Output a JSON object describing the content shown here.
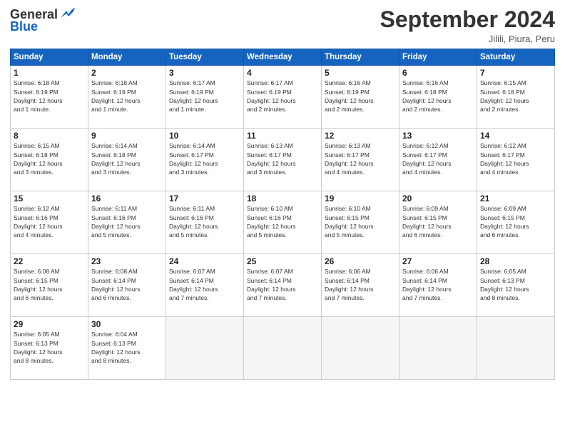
{
  "logo": {
    "general": "General",
    "blue": "Blue",
    "bird_symbol": "▶"
  },
  "title": "September 2024",
  "subtitle": "Jilili, Piura, Peru",
  "header_days": [
    "Sunday",
    "Monday",
    "Tuesday",
    "Wednesday",
    "Thursday",
    "Friday",
    "Saturday"
  ],
  "weeks": [
    [
      {
        "day": "1",
        "info": "Sunrise: 6:18 AM\nSunset: 6:19 PM\nDaylight: 12 hours\nand 1 minute."
      },
      {
        "day": "2",
        "info": "Sunrise: 6:18 AM\nSunset: 6:19 PM\nDaylight: 12 hours\nand 1 minute."
      },
      {
        "day": "3",
        "info": "Sunrise: 6:17 AM\nSunset: 6:19 PM\nDaylight: 12 hours\nand 1 minute."
      },
      {
        "day": "4",
        "info": "Sunrise: 6:17 AM\nSunset: 6:19 PM\nDaylight: 12 hours\nand 2 minutes."
      },
      {
        "day": "5",
        "info": "Sunrise: 6:16 AM\nSunset: 6:19 PM\nDaylight: 12 hours\nand 2 minutes."
      },
      {
        "day": "6",
        "info": "Sunrise: 6:16 AM\nSunset: 6:18 PM\nDaylight: 12 hours\nand 2 minutes."
      },
      {
        "day": "7",
        "info": "Sunrise: 6:15 AM\nSunset: 6:18 PM\nDaylight: 12 hours\nand 2 minutes."
      }
    ],
    [
      {
        "day": "8",
        "info": "Sunrise: 6:15 AM\nSunset: 6:18 PM\nDaylight: 12 hours\nand 3 minutes."
      },
      {
        "day": "9",
        "info": "Sunrise: 6:14 AM\nSunset: 6:18 PM\nDaylight: 12 hours\nand 3 minutes."
      },
      {
        "day": "10",
        "info": "Sunrise: 6:14 AM\nSunset: 6:17 PM\nDaylight: 12 hours\nand 3 minutes."
      },
      {
        "day": "11",
        "info": "Sunrise: 6:13 AM\nSunset: 6:17 PM\nDaylight: 12 hours\nand 3 minutes."
      },
      {
        "day": "12",
        "info": "Sunrise: 6:13 AM\nSunset: 6:17 PM\nDaylight: 12 hours\nand 4 minutes."
      },
      {
        "day": "13",
        "info": "Sunrise: 6:12 AM\nSunset: 6:17 PM\nDaylight: 12 hours\nand 4 minutes."
      },
      {
        "day": "14",
        "info": "Sunrise: 6:12 AM\nSunset: 6:17 PM\nDaylight: 12 hours\nand 4 minutes."
      }
    ],
    [
      {
        "day": "15",
        "info": "Sunrise: 6:12 AM\nSunset: 6:16 PM\nDaylight: 12 hours\nand 4 minutes."
      },
      {
        "day": "16",
        "info": "Sunrise: 6:11 AM\nSunset: 6:16 PM\nDaylight: 12 hours\nand 5 minutes."
      },
      {
        "day": "17",
        "info": "Sunrise: 6:11 AM\nSunset: 6:16 PM\nDaylight: 12 hours\nand 5 minutes."
      },
      {
        "day": "18",
        "info": "Sunrise: 6:10 AM\nSunset: 6:16 PM\nDaylight: 12 hours\nand 5 minutes."
      },
      {
        "day": "19",
        "info": "Sunrise: 6:10 AM\nSunset: 6:15 PM\nDaylight: 12 hours\nand 5 minutes."
      },
      {
        "day": "20",
        "info": "Sunrise: 6:09 AM\nSunset: 6:15 PM\nDaylight: 12 hours\nand 6 minutes."
      },
      {
        "day": "21",
        "info": "Sunrise: 6:09 AM\nSunset: 6:15 PM\nDaylight: 12 hours\nand 6 minutes."
      }
    ],
    [
      {
        "day": "22",
        "info": "Sunrise: 6:08 AM\nSunset: 6:15 PM\nDaylight: 12 hours\nand 6 minutes."
      },
      {
        "day": "23",
        "info": "Sunrise: 6:08 AM\nSunset: 6:14 PM\nDaylight: 12 hours\nand 6 minutes."
      },
      {
        "day": "24",
        "info": "Sunrise: 6:07 AM\nSunset: 6:14 PM\nDaylight: 12 hours\nand 7 minutes."
      },
      {
        "day": "25",
        "info": "Sunrise: 6:07 AM\nSunset: 6:14 PM\nDaylight: 12 hours\nand 7 minutes."
      },
      {
        "day": "26",
        "info": "Sunrise: 6:06 AM\nSunset: 6:14 PM\nDaylight: 12 hours\nand 7 minutes."
      },
      {
        "day": "27",
        "info": "Sunrise: 6:06 AM\nSunset: 6:14 PM\nDaylight: 12 hours\nand 7 minutes."
      },
      {
        "day": "28",
        "info": "Sunrise: 6:05 AM\nSunset: 6:13 PM\nDaylight: 12 hours\nand 8 minutes."
      }
    ],
    [
      {
        "day": "29",
        "info": "Sunrise: 6:05 AM\nSunset: 6:13 PM\nDaylight: 12 hours\nand 8 minutes."
      },
      {
        "day": "30",
        "info": "Sunrise: 6:04 AM\nSunset: 6:13 PM\nDaylight: 12 hours\nand 8 minutes."
      },
      {
        "day": "",
        "info": ""
      },
      {
        "day": "",
        "info": ""
      },
      {
        "day": "",
        "info": ""
      },
      {
        "day": "",
        "info": ""
      },
      {
        "day": "",
        "info": ""
      }
    ]
  ]
}
